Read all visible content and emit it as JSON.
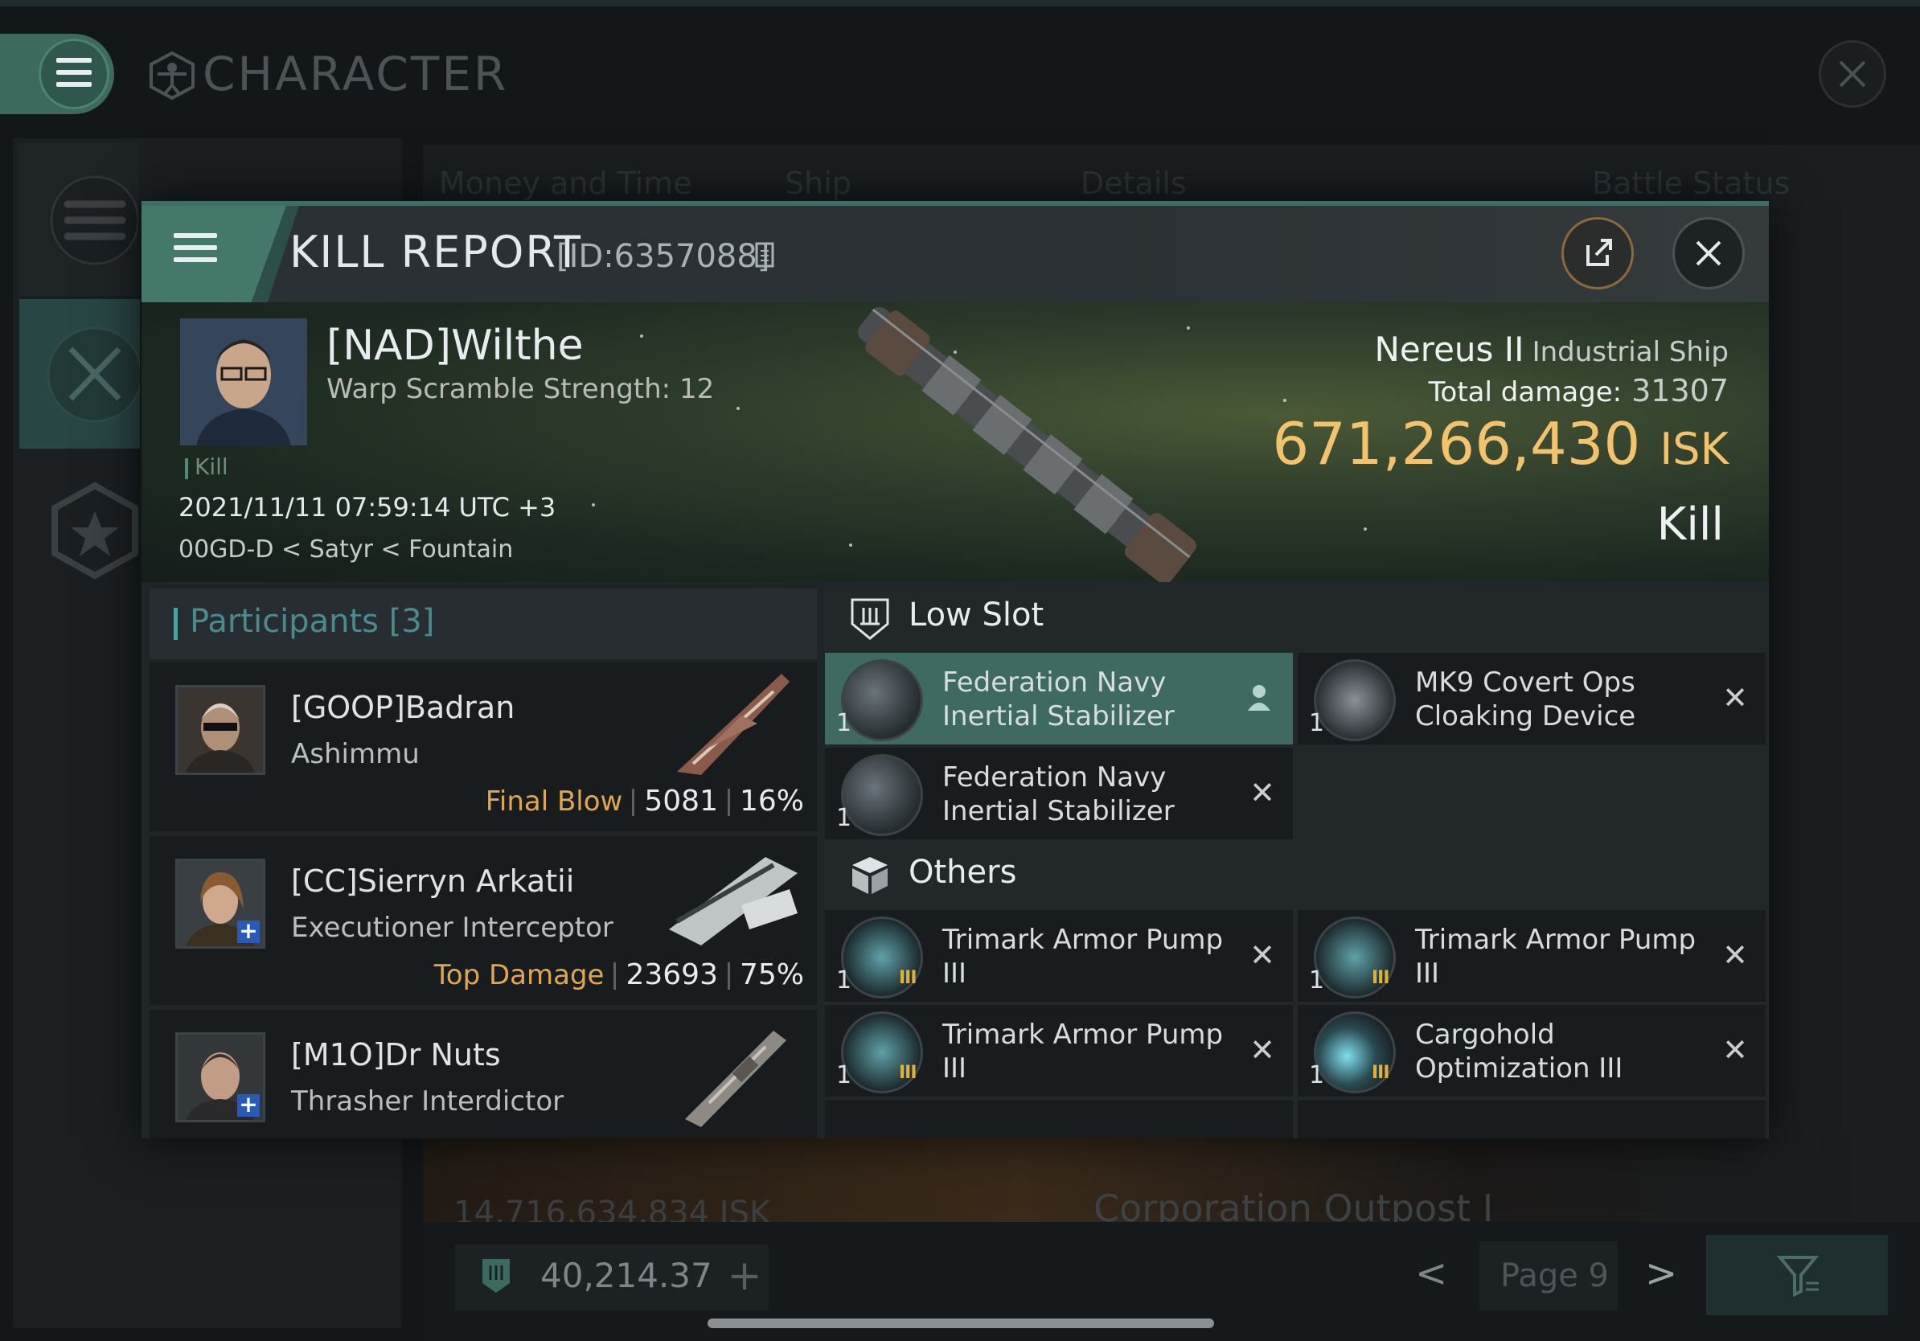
{
  "character_window": {
    "title": "CHARACTER",
    "columns": [
      "Money and Time",
      "Ship",
      "Details",
      "Battle Status"
    ],
    "background_row": {
      "isk": "14,716,634,834 ISK",
      "location": "Corporation Outpost I"
    },
    "wallet": "40,214.37",
    "wallet_add": "+",
    "page_label": "Page 9",
    "prev": "<",
    "next": ">"
  },
  "kill_report": {
    "title": "KILL REPORT",
    "report_id": "[ID:6357088]",
    "victim": {
      "name": "[NAD]Wilthe",
      "warp_scramble": "Warp Scramble Strength: 12",
      "tag": "Kill",
      "timestamp": "2021/11/11 07:59:14 UTC +3",
      "location": "00GD-D < Satyr < Fountain"
    },
    "ship": {
      "name": "Nereus II",
      "class": "Industrial Ship"
    },
    "total_damage_label": "Total damage:",
    "total_damage": "31307",
    "isk_value": "671,266,430",
    "isk_unit": "ISK",
    "result": "Kill"
  },
  "participants": {
    "title": "Participants",
    "count": "[3]",
    "rows": [
      {
        "name": "[GOOP]Badran",
        "ship": "Ashimmu",
        "tag": "Final Blow",
        "damage": "5081",
        "percent": "16%"
      },
      {
        "name": "[CC]Sierryn Arkatii",
        "ship": "Executioner Interceptor",
        "tag": "Top Damage",
        "damage": "23693",
        "percent": "75%"
      },
      {
        "name": "[M1O]Dr Nuts",
        "ship": "Thrasher Interdictor",
        "tag": "",
        "damage": "",
        "percent": ""
      }
    ]
  },
  "fitting": {
    "low_slot": {
      "title": "Low Slot",
      "items": [
        {
          "qty": "1",
          "name": "Federation Navy Inertial Stabilizer",
          "state": "destroyed-selected"
        },
        {
          "qty": "1",
          "name": "MK9 Covert Ops Cloaking Device",
          "state": "destroyed"
        },
        {
          "qty": "1",
          "name": "Federation Navy Inertial Stabilizer",
          "state": "destroyed"
        }
      ]
    },
    "others": {
      "title": "Others",
      "items": [
        {
          "qty": "1",
          "name": "Trimark Armor Pump III",
          "tier": "III"
        },
        {
          "qty": "1",
          "name": "Trimark Armor Pump III",
          "tier": "III"
        },
        {
          "qty": "1",
          "name": "Trimark Armor Pump III",
          "tier": "III"
        },
        {
          "qty": "1",
          "name": "Cargohold Optimization III",
          "tier": "III"
        }
      ]
    },
    "destroyed_mark": "✕",
    "dropped_mark": "person-icon"
  },
  "colors": {
    "accent": "#3f6a61",
    "isk": "#f2c36c",
    "tag": "#e2a64e",
    "teal": "#4a8c8e"
  }
}
